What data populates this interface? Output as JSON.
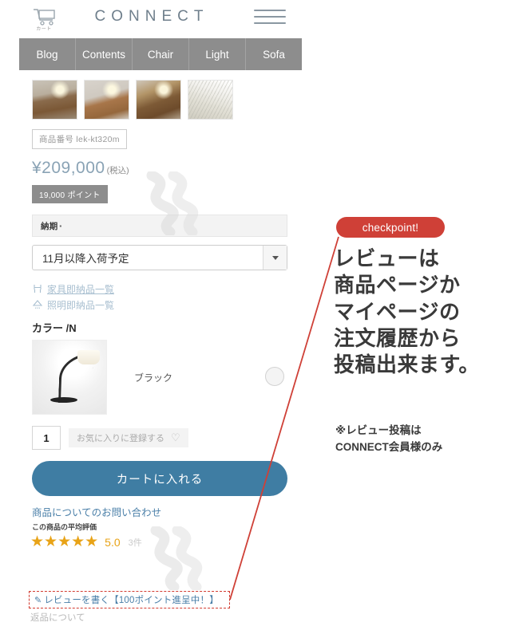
{
  "header": {
    "brand": "CONNECT",
    "cart_label": "カート",
    "cart_icon": "shopping-cart-icon",
    "menu_icon": "hamburger-menu-icon"
  },
  "nav": {
    "tabs": [
      {
        "label": "Blog"
      },
      {
        "label": "Contents"
      },
      {
        "label": "Chair"
      },
      {
        "label": "Light"
      },
      {
        "label": "Sofa"
      }
    ]
  },
  "product": {
    "thumbnails": [
      {
        "alt": "dining-room-with-arc-floor-lamp"
      },
      {
        "alt": "sideboard-with-arc-floor-lamp"
      },
      {
        "alt": "study-desk-with-arc-floor-lamp"
      },
      {
        "alt": "pleated-lamp-shade-closeup"
      }
    ],
    "sku_label": "商品番号",
    "sku_value": "lek-kt320m",
    "price": "¥209,000",
    "price_tax_note": "(税込)",
    "points_badge": "19,000 ポイント",
    "delivery_section_label": "納期",
    "delivery_selected": "11月以降入荷予定",
    "stock_links": [
      {
        "label": "家具即納品一覧",
        "icon": "chair-icon"
      },
      {
        "label": "照明即納品一覧",
        "icon": "lamp-icon"
      }
    ],
    "color_title": "カラー /N",
    "color_name": "ブラック",
    "quantity": "1",
    "favorite_label": "お気に入りに登録する",
    "favorite_icon": "heart-icon",
    "add_to_cart_label": "カートに入れる",
    "inquiry_label": "商品についてのお問い合わせ",
    "rating_caption": "この商品の平均評価",
    "rating_stars": "★★★★★",
    "rating_value": "5.0",
    "rating_count": "3件",
    "review_link_label": "レビューを書く【100ポイント進呈中！】",
    "review_link_icon": "pencil-icon",
    "returns_label": "返品について"
  },
  "annotation": {
    "chip_label": "checkpoint!",
    "headline": "レビューは\n商品ページか\nマイページの\n注文履歴から\n投稿出来ます。",
    "note": "※レビュー投稿は\nCONNECT会員様のみ",
    "accent_color": "#cf4037"
  },
  "colors": {
    "nav_bg": "#8d8d8d",
    "brand_text": "#6f7f8c",
    "price_text": "#8aa3b5",
    "cart_button": "#3f7da3",
    "link_blue": "#4a7fa8",
    "star_gold": "#e8a317",
    "annotation_red": "#cf4037"
  }
}
